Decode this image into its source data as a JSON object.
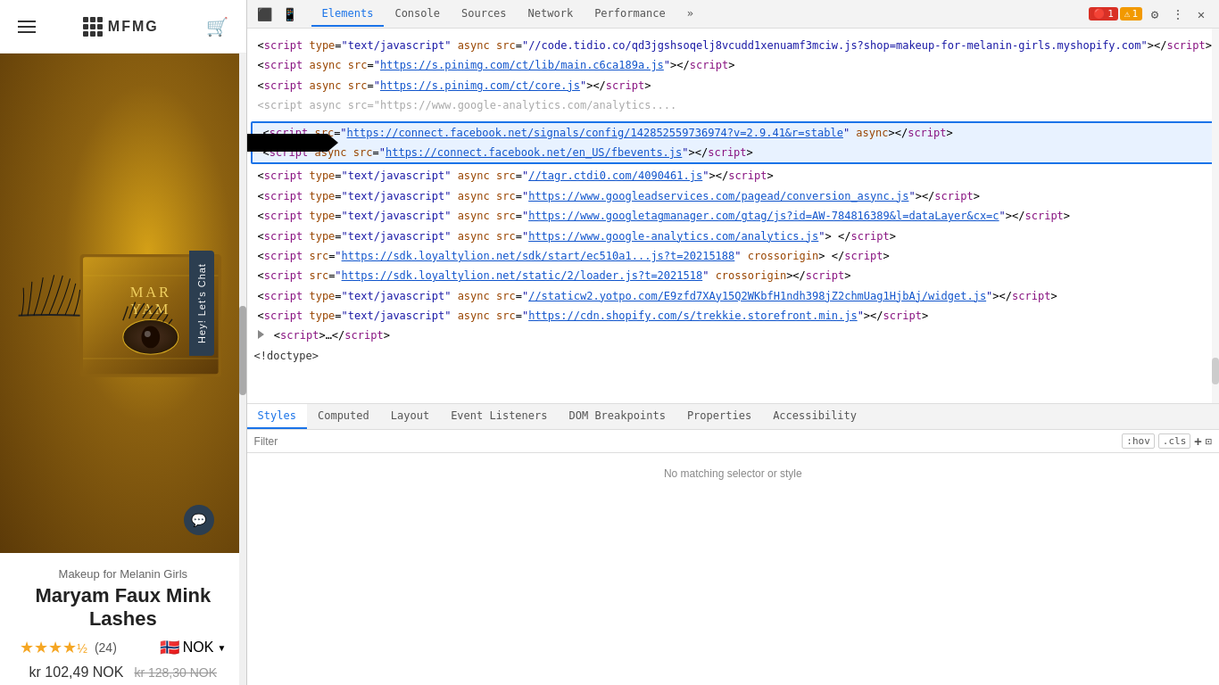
{
  "website": {
    "brand": "MFMG",
    "product_brand": "Makeup for Melanin Girls",
    "product_name": "Maryam Faux Mink Lashes",
    "rating": "★★★★",
    "half_star": "½",
    "review_count": "(24)",
    "price_current": "kr 102,49 NOK",
    "price_original": "kr 128,30 NOK",
    "currency": "NOK",
    "chat_button_label": "Hey! Let's Chat"
  },
  "devtools": {
    "tabs": [
      {
        "id": "elements",
        "label": "Elements",
        "active": true
      },
      {
        "id": "console",
        "label": "Console",
        "active": false
      },
      {
        "id": "sources",
        "label": "Sources",
        "active": false
      },
      {
        "id": "network",
        "label": "Network",
        "active": false
      },
      {
        "id": "performance",
        "label": "Performance",
        "active": false
      },
      {
        "id": "more",
        "label": "»",
        "active": false
      }
    ],
    "error_count": "1",
    "warn_count": "1",
    "styles_tabs": [
      {
        "id": "styles",
        "label": "Styles",
        "active": true
      },
      {
        "id": "computed",
        "label": "Computed",
        "active": false
      },
      {
        "id": "layout",
        "label": "Layout",
        "active": false
      },
      {
        "id": "event-listeners",
        "label": "Event Listeners",
        "active": false
      },
      {
        "id": "dom-breakpoints",
        "label": "DOM Breakpoints",
        "active": false
      },
      {
        "id": "properties",
        "label": "Properties",
        "active": false
      },
      {
        "id": "accessibility",
        "label": "Accessibility",
        "active": false
      }
    ],
    "filter_placeholder": "Filter",
    "filter_hov": ":hov",
    "filter_cls": ".cls",
    "no_matching_text": "No matching selector or style",
    "dom_lines": [
      {
        "id": "line1",
        "indent": 0,
        "html": "&lt;<span class='tag'>script</span> <span class='attr-name'>type</span>=<span class='attr-val'>\"text/javascript\"</span> <span class='attr-name'>async</span> <span class='attr-name'>src</span>=<span class='attr-val'>\"//code.tidio.co/qd3jgshsoqelj8vcudd1xenuamf3mciw.js?shop=makeup-for-melanin-girls.myshopify.com\"</span>&gt;&lt;/<span class='tag'>script</span>&gt;"
      },
      {
        "id": "line2",
        "indent": 0,
        "html": "&lt;<span class='tag'>script</span> <span class='attr-name'>async</span> <span class='attr-name'>src</span>=<span class='attr-val'>\"https://s.pinimg.com/ct/lib/main.c6ca189a.js\"</span>&gt;&lt;/<span class='tag'>script</span>&gt;"
      },
      {
        "id": "line3",
        "indent": 0,
        "html": "&lt;<span class='tag'>script</span> <span class='attr-name'>async</span> <span class='attr-name'>src</span>=<span class='attr-val'>\"https://s.pinimg.com/ct/core.js\"</span>&gt;&lt;/<span class='tag'>script</span>&gt;"
      },
      {
        "id": "line4",
        "indent": 0,
        "html": "&lt;<span class='tag'>script</span> <span class='attr-name'>async</span> <span class='attr-name'>src</span>=<span class='attr-val'>\"https://www.google-analytics.com/analytics.js\"</span>&gt;&lt;/<span class='tag'>script</span>&gt;"
      },
      {
        "id": "highlighted_line1",
        "highlighted": true,
        "html": "&lt;<span class='tag'>script</span> <span class='attr-name'>src</span>=<span class='attr-val'>\"https://connect.facebook.net/signals/config/142852559736974?v=2.9.41&amp;r=stable\"</span> <span class='attr-name'>async</span>&gt;&lt;/<span class='tag'>script</span>&gt;"
      },
      {
        "id": "highlighted_line2",
        "highlighted": true,
        "html": "&lt;<span class='tag'>script</span> <span class='attr-name'>async</span> <span class='attr-name'>src</span>=<span class='attr-val'>\"https://connect.facebook.net/en_US/fbevents.js\"</span>&gt;&lt;/<span class='tag'>script</span>&gt;"
      },
      {
        "id": "line5",
        "indent": 0,
        "html": "&lt;<span class='tag'>script</span> <span class='attr-name'>type</span>=<span class='attr-val'>\"text/javascript\"</span> <span class='attr-name'>async</span> <span class='attr-name'>src</span>=<span class='attr-val'>\"//tagr.ctdi0.com/4090461.js\"</span>&gt;&lt;/<span class='tag'>script</span>&gt;"
      },
      {
        "id": "line6a",
        "indent": 0,
        "html": "&lt;<span class='tag'>script</span> <span class='attr-name'>type</span>=<span class='attr-val'>\"text/javascript\"</span> <span class='attr-name'>async</span> <span class='attr-name'>src</span>=<span class='attr-val'>\"https://www.googleadservices.com/pagead/conversion_async.js\"</span>&gt;&lt;/<span class='tag'>script</span>&gt;"
      },
      {
        "id": "line7",
        "indent": 0,
        "html": "&lt;<span class='tag'>script</span> <span class='attr-name'>type</span>=<span class='attr-val'>\"text/javascript\"</span> <span class='attr-name'>async</span> <span class='attr-name'>src</span>=<span class='attr-val'>\"https://www.googletagmanager.com/gtag/js?id=AW-784816389&amp;l=dataLayer&amp;cx=c\"</span>&gt;&lt;/<span class='tag'>script</span>&gt;"
      },
      {
        "id": "line8",
        "indent": 0,
        "html": "&lt;<span class='tag'>script</span> <span class='attr-name'>type</span>=<span class='attr-val'>\"text/javascript\"</span> <span class='attr-name'>async</span> <span class='attr-name'>src</span>=<span class='attr-val'>\"https://www.google-analytics.com/analytics.js\"</span>&gt; &lt;/<span class='tag'>script</span>&gt;"
      },
      {
        "id": "line9",
        "indent": 0,
        "html": "&lt;<span class='tag'>script</span> <span class='attr-name'>src</span>=<span class='attr-val'>\"https://sdk.loyaltylion.net/sdk/start/ec510a1...js?t=20215188\"</span> <span class='attr-name'>crossorigin</span>&gt; &lt;/<span class='tag'>script</span>&gt;"
      },
      {
        "id": "line10",
        "indent": 0,
        "html": "&lt;<span class='tag'>script</span> <span class='attr-name'>src</span>=<span class='attr-val'>\"https://sdk.loyaltylion.net/static/2/loader.js?t=2021518\"</span> <span class='attr-name'>crossorigin</span>&gt;&lt;/<span class='tag'>script</span>&gt;"
      },
      {
        "id": "line11",
        "indent": 0,
        "html": "&lt;<span class='tag'>script</span> <span class='attr-name'>type</span>=<span class='attr-val'>\"text/javascript\"</span> <span class='attr-name'>async</span> <span class='attr-name'>src</span>=<span class='attr-val'>\"//staticw2.yotpo.com/E9zfd7XAy15Q2WKbfH1ndh398jZ2chmUag1HjbAj/widget.js\"</span>&gt;&lt;/<span class='tag'>script</span>&gt;"
      },
      {
        "id": "line12",
        "indent": 0,
        "html": "&lt;<span class='tag'>script</span> <span class='attr-name'>type</span>=<span class='attr-val'>\"text/javascript\"</span> <span class='attr-name'>async</span> <span class='attr-name'>src</span>=<span class='attr-val'>\"https://cdn.shopify.com/s/trekkie.storefront.min.js\"</span>&gt;&lt;/<span class='tag'>script</span>&gt;"
      },
      {
        "id": "line13",
        "indent": 0,
        "html": "<span class='triangle-right'></span> &lt;<span class='tag'>script</span>&gt;…&lt;/<span class='tag'>script</span>&gt;"
      },
      {
        "id": "doctype",
        "indent": 0,
        "html": "&lt;!doctype&gt;"
      }
    ]
  }
}
